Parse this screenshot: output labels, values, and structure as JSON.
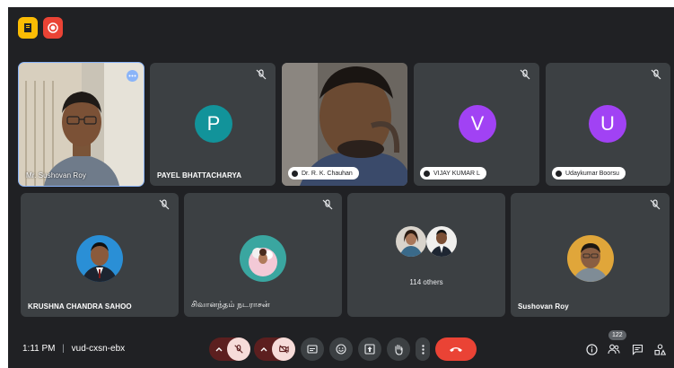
{
  "meeting": {
    "time": "1:11 PM",
    "separator": "|",
    "code": "vud-cxsn-ebx"
  },
  "participants_count": "122",
  "tiles": [
    {
      "name": "Mr. Sushovan Roy",
      "type": "video",
      "active": true
    },
    {
      "name": "PAYEL BHATTACHARYA",
      "type": "avatar",
      "initial": "P",
      "color": "#12939a",
      "muted": true
    },
    {
      "name": "Dr. R. K. Chauhan",
      "type": "video"
    },
    {
      "name": "VIJAY KUMAR L",
      "type": "avatar",
      "initial": "V",
      "color": "#a142f4",
      "muted": true
    },
    {
      "name": "Udaykumar Boorsu",
      "type": "avatar",
      "initial": "U",
      "color": "#a142f4",
      "muted": true
    },
    {
      "name": "KRUSHNA CHANDRA SAHOO",
      "type": "photo",
      "muted": true
    },
    {
      "name": "சிவானந்தம் நடராசன்",
      "type": "photo",
      "muted": true
    },
    {
      "name": "114 others",
      "type": "others"
    },
    {
      "name": "Sushovan Roy",
      "type": "photo",
      "muted": true
    }
  ],
  "colors": {
    "background": "#202124",
    "tile": "#3c4043",
    "red": "#ea4335",
    "dark_red": "#5c1f1f",
    "yellow": "#fbbc04",
    "active_border": "#8ab4f8"
  }
}
